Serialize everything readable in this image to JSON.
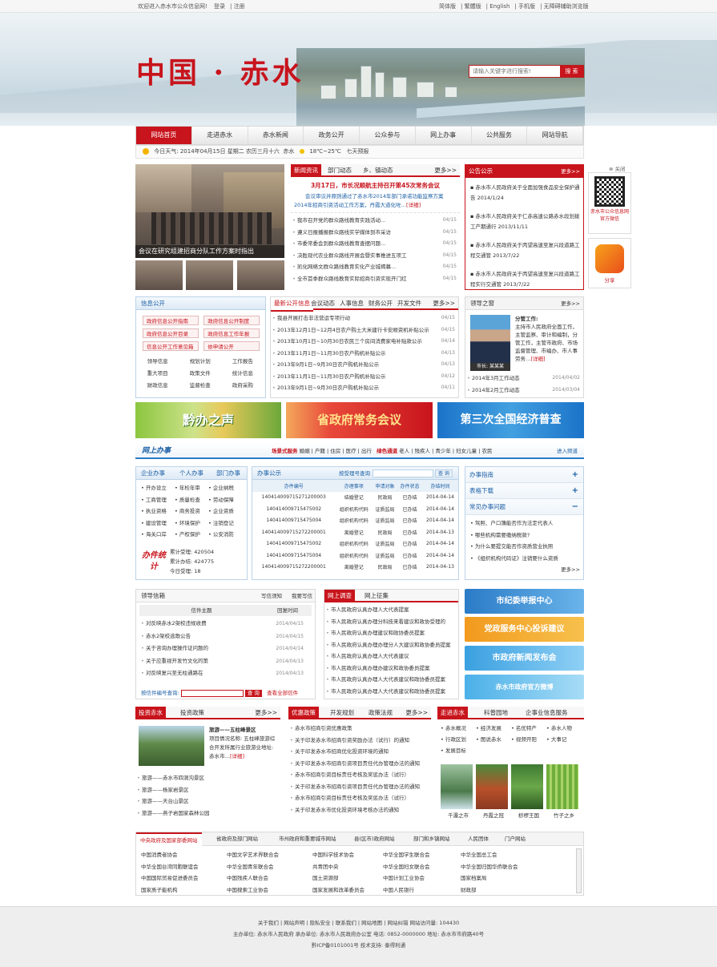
{
  "topbar": {
    "welcome": "欢迎进入赤水市公众信息网!",
    "login": "登录",
    "register": "注册",
    "right": [
      "简体版",
      "繁體版",
      "English",
      "手机版",
      "无障碍辅助浏览版"
    ]
  },
  "logo": "中国 · 赤水",
  "search": {
    "placeholder": "请输入关键字进行搜索!",
    "button": "搜 索"
  },
  "nav": [
    "网站首页",
    "走进赤水",
    "赤水新闻",
    "政务公开",
    "公众参与",
    "网上办事",
    "公共服务",
    "网站导航"
  ],
  "weather": {
    "label": "今日天气:",
    "date": "2014年04月15日",
    "week": "星期二",
    "lunar": "农历三月十六",
    "city": "赤水",
    "temp": "18℃~25℃",
    "wind": "七天预报"
  },
  "photo_caption": "会议在研究组建招商分队工作方案时指出",
  "news": {
    "tabs": [
      "新闻资讯",
      "部门动态",
      "乡、镇动态"
    ],
    "more": "更多>>",
    "headline": "3月17日，市长况顺航主持召开第45次常务会议",
    "summary": "会议审议并原则通过了赤水市2014年部门承诺功能监察方案2014年招商引资活动工作方案，丹霞大道化咗…",
    "detail": "[详细]",
    "items": [
      {
        "t": "我市召开党的群众路线教育实践活动...",
        "d": "04/15"
      },
      {
        "t": "遵义日报播报群众路线实学媒体到市采访",
        "d": "04/15"
      },
      {
        "t": "市委常委会到群众路线教育查摆问题...",
        "d": "04/15"
      },
      {
        "t": "决胜现代农业群众路线开展会暨实事推进五项工",
        "d": "04/15"
      },
      {
        "t": "凯化网络文群众路线教育实化产业城揭幕...",
        "d": "04/15"
      },
      {
        "t": "全市首季群众路线教育实际招商引资实现开门红",
        "d": "04/15"
      }
    ]
  },
  "notice": {
    "title": "公告公示",
    "more": "更多>>",
    "items": [
      {
        "t": "赤水市人民政府关于全面加强食品安全保护通告",
        "d": "2014/1/24"
      },
      {
        "t": "赤水市人民政府关于仁赤高速公路赤水段划拨工产期通行",
        "d": "2013/11/11"
      },
      {
        "t": "赤水市人民政府关于丙望高速至复兴段道路工程交通管",
        "d": "2013/7/22"
      },
      {
        "t": "赤水市人民政府关于丙望高速至复兴段道路工程实行交通管",
        "d": "2013/7/22"
      }
    ]
  },
  "qr": {
    "close": "⊗ 关闭",
    "label": "赤水市公众信息网官方微信",
    "share": "分享"
  },
  "xxgk": {
    "title": "信息公开",
    "btns": [
      "政府信息公开指南",
      "政府信息公开制度",
      "政府信息公开目录",
      "政府信息工作年报",
      "信息公开工作意见箱",
      "依申请公开"
    ],
    "grid": [
      "领导信息",
      "规划计划",
      "工作报告",
      "重大项目",
      "政策文件",
      "统计信息",
      "财政信息",
      "监督检查",
      "政府采购"
    ]
  },
  "xxgk_list": {
    "tabs": [
      "最新公开信息",
      "会议动态",
      "人事信息",
      "财务公开",
      "开发文件"
    ],
    "more": "更多>>",
    "items": [
      {
        "t": "我县开展打击非法营运专项行动",
        "d": "04/15"
      },
      {
        "t": "2013年12月1日~12月4日农户购土大米建行卡安顺资机补贴公示",
        "d": "04/15"
      },
      {
        "t": "2013年10月1日~10月30日农民三个房间消费家电补贴款公示",
        "d": "04/14"
      },
      {
        "t": "2013年11月1日~11月30日农户购机补贴公示",
        "d": "04/13"
      },
      {
        "t": "2013年9月1日~9月30日农户购机补贴公示",
        "d": "04/13"
      },
      {
        "t": "2013年11月1日~11月30日农户购机补贴公示",
        "d": "04/12"
      },
      {
        "t": "2013年9月1日~9月30日农户购机补贴公示",
        "d": "04/11"
      }
    ]
  },
  "leader": {
    "title": "领导之窗",
    "more": "更多>>",
    "duty_title": "分管工作:",
    "duty": "主持市人民政府全面工作，主管监察、审计和编制，分管工作，主管市政府、市场监督管理、市编办、市人事劳务…",
    "detail": "[详细]",
    "name": "市长: 某某某",
    "items": [
      {
        "t": "2014年3月工作动态",
        "d": "2014/04/02"
      },
      {
        "t": "2014年2月工作动态",
        "d": "2014/03/04"
      }
    ]
  },
  "ads": [
    "黔办之声",
    "省政府常务会议",
    "第三次全国经济普查"
  ],
  "online": {
    "title": "网上办事",
    "scene": "场景式服务",
    "scene_items": [
      "婚姻",
      "户籍",
      "住房",
      "医疗",
      "出行"
    ],
    "green": "绿色通道",
    "green_items": [
      "老人",
      "残疾人",
      "青少年",
      "妇女儿童",
      "农民"
    ],
    "enter": "进入频道"
  },
  "biz": {
    "tabs": [
      "企业办事",
      "个人办事",
      "部门办事"
    ],
    "items": [
      "开办设立",
      "年检年审",
      "企业纳税",
      "工商管理",
      "质量检查",
      "劳动保障",
      "执业资格",
      "商务投资",
      "企业资质",
      "建设管理",
      "环境保护",
      "注销登记",
      "海关口岸",
      "产权保护",
      "公安消防"
    ],
    "stat_title": "办件统计",
    "stats": [
      {
        "l": "累计受理:",
        "v": "420504"
      },
      {
        "l": "累计办结:",
        "v": "424775"
      },
      {
        "l": "今日受理:",
        "v": "18"
      }
    ]
  },
  "bsgs": {
    "title": "办事公示",
    "query": "按受理号查询",
    "qbtn": "查 询",
    "cols": [
      "办件编号",
      "办理事项",
      "申请对象",
      "办件状态",
      "办结时间"
    ],
    "rows": [
      [
        "140414009715271200003",
        "结婚登记",
        "民政局",
        "已办结",
        "2014-04-14"
      ],
      [
        "140414009715475002",
        "组织机构代码",
        "证质监局",
        "已办结",
        "2014-04-14"
      ],
      [
        "140414009715475004",
        "组织机构代码",
        "证质监局",
        "已办结",
        "2014-04-14"
      ],
      [
        "140414009715272200001",
        "离婚登记",
        "民政局",
        "已办结",
        "2014-04-13"
      ],
      [
        "140414009715475002",
        "组织机构代码",
        "证质监局",
        "已办结",
        "2014-04-14"
      ],
      [
        "140414009715475004",
        "组织机构代码",
        "证质监局",
        "已办结",
        "2014-04-14"
      ],
      [
        "140414009715272200001",
        "离婚登记",
        "民政局",
        "已办结",
        "2014-04-13"
      ]
    ]
  },
  "guide": {
    "items": [
      "办事指南",
      "表格下载",
      "常见办事问题"
    ],
    "faq": [
      "驾照、户口簿能否作为法定代表人",
      "哪些机构需要缴纳税款?",
      "为什么要提交能否作资质营业执照",
      "《组织机构代码证》注销要什么资质"
    ],
    "more": "更多>>"
  },
  "letters": {
    "title": "领导信箱",
    "links": [
      "写信须知",
      "我要写信"
    ],
    "cols": [
      "信件主题",
      "回复时间"
    ],
    "rows": [
      [
        "对反映赤水2架校违规收费",
        "2014/04/15"
      ],
      [
        "赤水2架校逃歌公告",
        "2014/04/15"
      ],
      [
        "关于咨询办理操作证问题的",
        "2014/04/14"
      ],
      [
        "关于应重视开发竹文化的策",
        "2014/04/13"
      ],
      [
        "对反映复兴至无柱通路在",
        "2014/04/13"
      ]
    ],
    "query": "按信件编号查询:",
    "qbtn": "查 询",
    "more": "查看全部信件"
  },
  "survey": {
    "tabs": [
      "网上调查",
      "网上征集"
    ],
    "items": [
      "市人民政府认真办理人大代表提案",
      "市人民政府认真办理分科技来看建议和政协受理的",
      "市人民政府认真办理建议和政协委员提案",
      "市人民政府认真办理办理分人大建议和政协委员提案",
      "市人民政府认真办理人大代表建议",
      "市人民政府认真办理办建议和政协委员提案",
      "市人民政府认真办理人大代表建议和政协委员提案",
      "市人民政府认真办理人大代表建议和政协委员提案"
    ]
  },
  "rightbtns": [
    "市纪委举报中心",
    "党政服务中心投诉建议",
    "市政府新闻发布会",
    "赤水市政府官方微博"
  ],
  "invest": {
    "tabs": [
      "投资赤水",
      "投资政策"
    ],
    "more": "更多>>",
    "spot": "旅游——五柱峰景区",
    "spot_desc": "项目情况名称: 五柱峰旅游综合开发所属行业旅游业地址: 赤水市…",
    "detail": "[详细]",
    "items": [
      "旅游——赤水市四洞沟景区",
      "旅游——杨家岩景区",
      "旅游——天台山景区",
      "旅游——燕子岩国家森林公园"
    ]
  },
  "policy": {
    "tabs": [
      "优惠政策",
      "开发规划",
      "政策法规"
    ],
    "more": "更多>>",
    "items": [
      "赤水市招商引资优惠政策",
      "关于印发赤水市招商引资奖励办法（试行）的通知",
      "关于印发赤水市招商优化投资环境的通知",
      "关于印发赤水市招商引资项目责任代办管理办法的通知",
      "赤水市招商引资目标责任考核及奖惩办法（试行）",
      "关于印发赤水市招商引资项目责任代办管理办法的通知",
      "赤水市招商引资目标责任考核及奖惩办法（试行）",
      "关于印发赤水市优化投资环境考核办法的通知"
    ]
  },
  "intro": {
    "tabs": [
      "走进赤水",
      "科普园地",
      "企事业信息服务"
    ],
    "grid": [
      "赤水概况",
      "经济发展",
      "名优特产",
      "赤水人物",
      "行政区划",
      "图说赤水",
      "视频开阳",
      "大事记",
      "发展目标"
    ],
    "pics": [
      "千瀑之市",
      "丹霞之冠",
      "桫椤王国",
      "竹子之乡"
    ]
  },
  "links": {
    "tabs": [
      "中央政府及国家部委网站",
      "省政府及部门网站",
      "市州政府和重要城市网站",
      "县(区市)政府网站",
      "部门和乡镇网站",
      "人民团体",
      "门户网站"
    ],
    "items": [
      "中国消费者协会",
      "中国文学艺术界联合会",
      "中国科学技术协会",
      "中华全国学生联合会",
      "中华全国总工会",
      "中华全国台湾同胞联谊会",
      "中华全国青年联合会",
      "共青团中央",
      "中华全国妇女联合会",
      "中华全国归国华侨联合会",
      "中国国际贸易促进委员会",
      "中国残疾人联合会",
      "国土资源部",
      "中国计划工业协会",
      "国家档案局",
      "国家质子能机构",
      "中国搜索工业协会",
      "国家发展和改革委员会",
      "中国人民银行",
      "财政部"
    ]
  },
  "footer": {
    "line1": "关于我们 | 网站声明 | 隐私安全 | 联系我们 | 网站地图 | 网站纠错  网站访问量: 104430",
    "line2": "主办单位: 赤水市人民政府   承办单位: 赤水市人民政府办公室   电话: 0852-0000000   地址: 赤水市市府路40号",
    "line3": "黔ICP备0101001号   技术支持: 泰得利通"
  }
}
